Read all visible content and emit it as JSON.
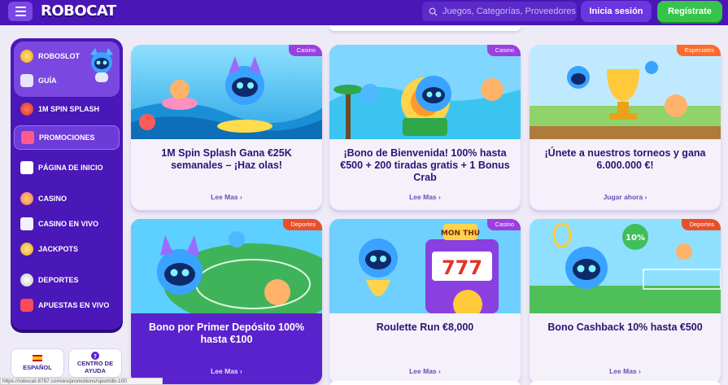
{
  "header": {
    "logo": "ROBOCAT",
    "search_placeholder": "Juegos, Categorías, Proveedores",
    "login_label": "Inicia sesión",
    "register_label": "Regístrate"
  },
  "sidebar": {
    "top_items": [
      {
        "label": "ROBOSLOT",
        "icon": "roboslot-icon"
      },
      {
        "label": "GUÍA",
        "icon": "guide-icon"
      }
    ],
    "items": [
      {
        "label": "1M SPIN SPLASH",
        "icon": "spin-splash-icon"
      },
      {
        "label": "PROMOCIONES",
        "icon": "gift-icon"
      },
      {
        "label": "PÁGINA DE INICIO",
        "icon": "home-icon"
      },
      {
        "label": "CASINO",
        "icon": "casino-chip-icon"
      },
      {
        "label": "CASINO EN VIVO",
        "icon": "live-casino-icon"
      },
      {
        "label": "JACKPOTS",
        "icon": "jackpot-icon"
      },
      {
        "label": "DEPORTES",
        "icon": "football-icon"
      },
      {
        "label": "APUESTAS EN VIVO",
        "icon": "live-bets-icon"
      }
    ],
    "language_label": "ESPAÑOL",
    "help_label_1": "CENTRO DE",
    "help_label_2": "AYUDA"
  },
  "cards": [
    {
      "badge": "Casino",
      "title": "1M Spin Splash Gana €25K semanales – ¡Haz olas!",
      "link": "Lee Mas"
    },
    {
      "badge": "Casino",
      "title": "¡Bono de Bienvenida! 100% hasta €500 + 200 tiradas gratis + 1 Bonus Crab",
      "link": "Lee Mas"
    },
    {
      "badge": "Especiales",
      "title": "¡Únete a nuestros torneos y gana 6.000.000 €!",
      "link": "Jugar ahora"
    },
    {
      "badge": "Deportes",
      "title": "Bono por Primer Depósito 100% hasta €100",
      "link": "Lee Mas"
    },
    {
      "badge": "Casino",
      "title": "Roulette Run €8,000",
      "link": "Lee Mas",
      "slot_text": "MON THU",
      "slot_digits": "777"
    },
    {
      "badge": "Deportes",
      "title": "Bono Cashback 10% hasta €500",
      "link": "Lee Mas",
      "bubble_text": "10%"
    }
  ],
  "statusbar": {
    "url": "https://robocat-8787.com/es/promotions/sport/db-100"
  },
  "colors": {
    "brand_purple": "#4a16b8",
    "accent_green": "#36c44a",
    "badge_casino": "#9a3fe0",
    "badge_especiales": "#ff6a2a",
    "badge_deportes": "#e8502b"
  }
}
